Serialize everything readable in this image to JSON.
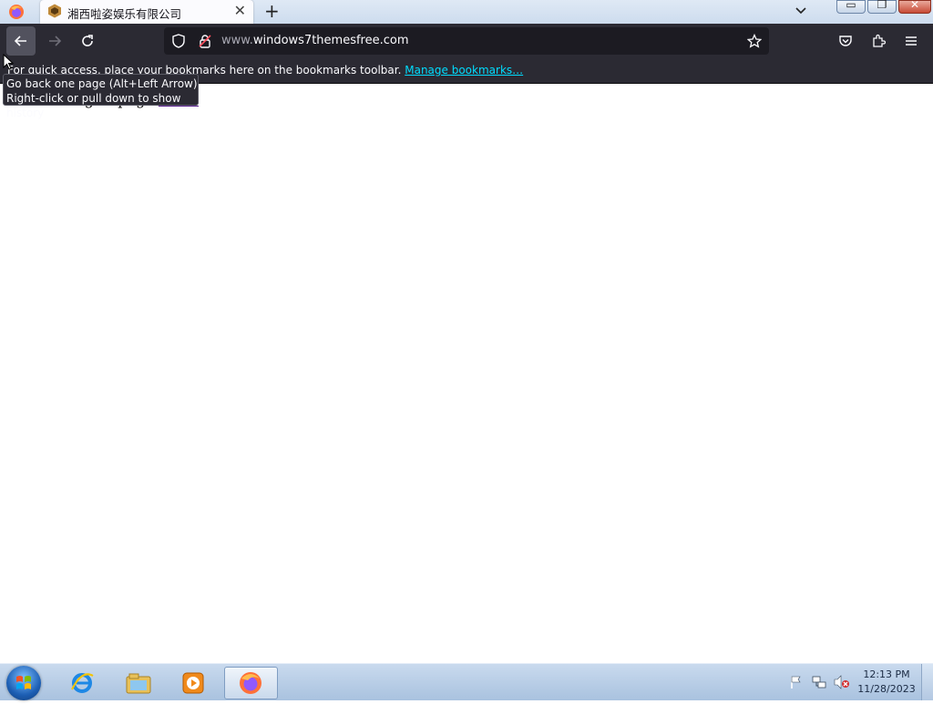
{
  "window": {
    "tab": {
      "title": "湘西啦姿娱乐有限公司",
      "favicon": "hexagon-logo-icon",
      "close_icon": "close-icon"
    },
    "new_tab_icon": "plus-icon",
    "tab_list_icon": "chevron-down-icon",
    "controls": {
      "minimize": "▭",
      "restore": "❐",
      "close": "✕"
    }
  },
  "nav": {
    "back_icon": "arrow-left-icon",
    "forward_icon": "arrow-right-icon",
    "reload_icon": "reload-icon",
    "url": {
      "prefix": "www.",
      "domain": "windows7themesfree.com"
    },
    "right_icons": [
      "pocket-icon",
      "extensions-icon",
      "hamburger-menu-icon"
    ]
  },
  "bookmarks_bar": {
    "message": "For quick access, place your bookmarks here on the bookmarks toolbar.",
    "link": "Manage bookmarks…"
  },
  "page": {
    "hidden_text": "Redirecting to page ",
    "link_text": "unter"
  },
  "tooltip": {
    "line1": "Go back one page (Alt+Left Arrow)",
    "line2": "Right-click or pull down to show history"
  },
  "taskbar": {
    "apps": [
      "internet-explorer-icon",
      "file-explorer-icon",
      "media-player-icon",
      "firefox-icon"
    ],
    "active_app": "firefox-icon",
    "tray": [
      "action-center-flag-icon",
      "network-icon",
      "volume-muted-icon"
    ],
    "time": "12:13 PM",
    "date": "11/28/2023"
  },
  "colors": {
    "toolbar_dark": "#2b2a33",
    "urlbar_bg": "#1c1b22",
    "link_cyan": "#00ddff",
    "visited_link": "#551a8b",
    "taskbar": "#b9cfe7"
  }
}
